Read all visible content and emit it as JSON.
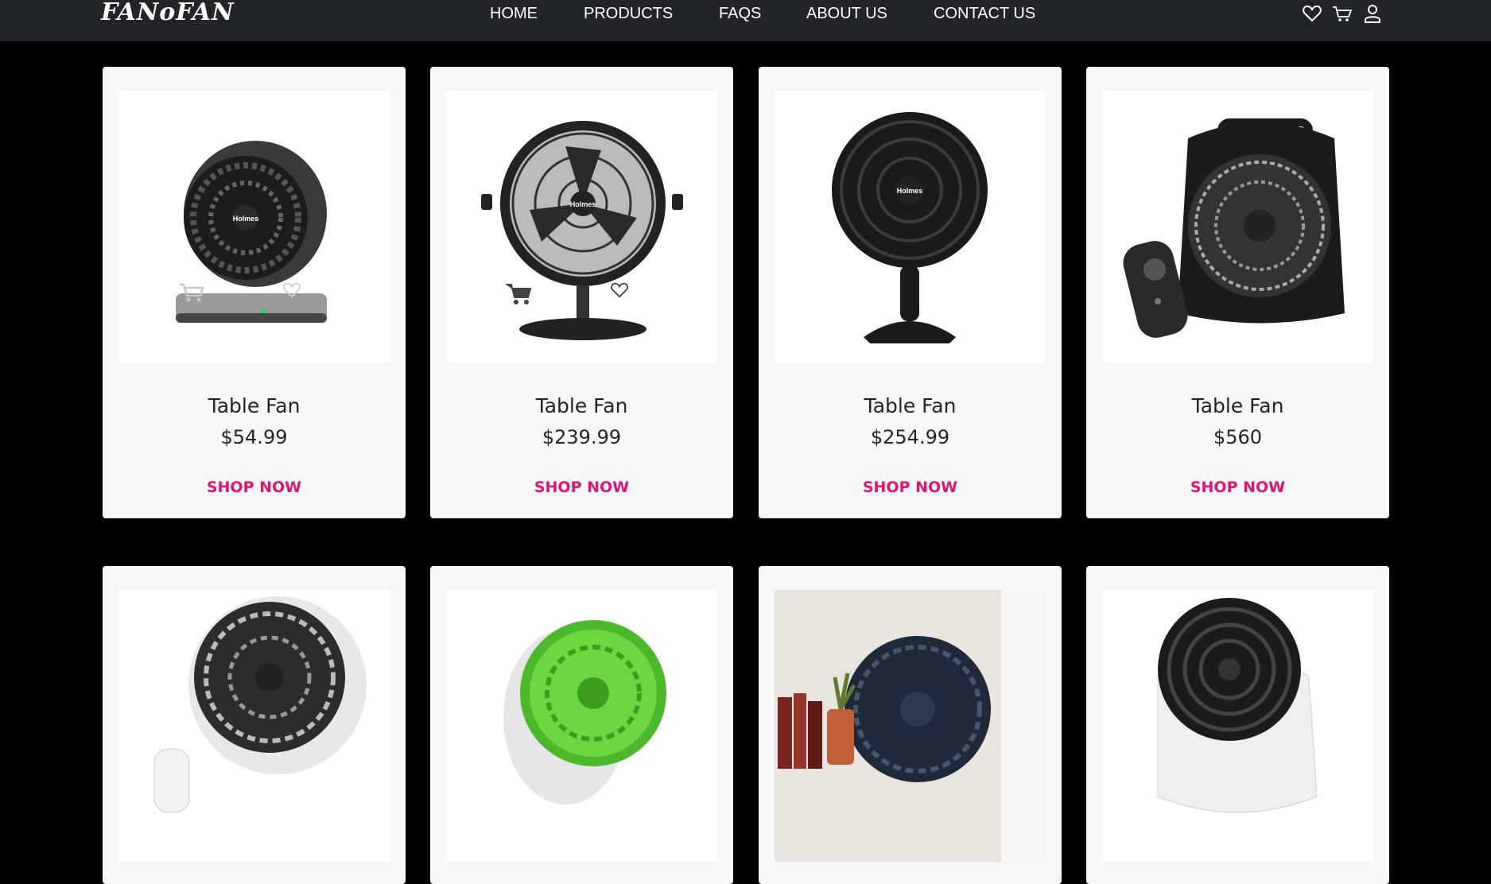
{
  "brand": {
    "logo_text": "FANoFAN"
  },
  "nav": {
    "links": [
      {
        "label": "HOME"
      },
      {
        "label": "PRODUCTS"
      },
      {
        "label": "FAQS"
      },
      {
        "label": "ABOUT US"
      },
      {
        "label": "CONTACT US"
      }
    ],
    "icons": [
      "heart-icon",
      "cart-icon",
      "user-icon"
    ]
  },
  "products": [
    {
      "name": "Table Fan",
      "price": "$54.99",
      "cta": "SHOP NOW",
      "image": "black-circulator-fan-holmes"
    },
    {
      "name": "Table Fan",
      "price": "$239.99",
      "cta": "SHOP NOW",
      "image": "retro-metal-fan-holmes"
    },
    {
      "name": "Table Fan",
      "price": "$254.99",
      "cta": "SHOP NOW",
      "image": "black-oscillating-desk-fan-holmes"
    },
    {
      "name": "Table Fan",
      "price": "$560",
      "cta": "SHOP NOW",
      "image": "box-fan-with-remote-holmes"
    },
    {
      "image": "white-black-circulator-fan-with-remote"
    },
    {
      "image": "green-clip-fan"
    },
    {
      "image": "black-fan-on-shelf-with-books"
    },
    {
      "image": "white-round-air-circulator"
    }
  ],
  "colors": {
    "accent": "#e0156f",
    "navbar": "#212529",
    "card": "#f7f7f8",
    "background": "#000000"
  }
}
